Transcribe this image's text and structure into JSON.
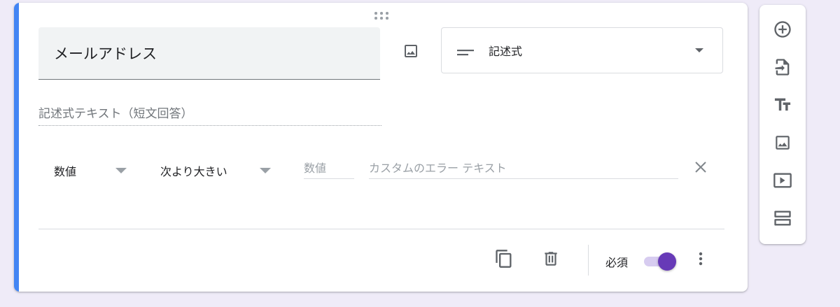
{
  "question": {
    "title": "メールアドレス",
    "type_label": "記述式",
    "answer_placeholder": "記述式テキスト（短文回答）"
  },
  "validation": {
    "type": "数値",
    "condition": "次より大きい",
    "number_placeholder": "数値",
    "error_placeholder": "カスタムのエラー テキスト"
  },
  "footer": {
    "required_label": "必須",
    "required_on": true
  },
  "sidebar": {
    "items": [
      {
        "icon": "add-circle-icon"
      },
      {
        "icon": "import-icon"
      },
      {
        "icon": "title-icon"
      },
      {
        "icon": "image-icon"
      },
      {
        "icon": "video-icon"
      },
      {
        "icon": "section-icon"
      }
    ]
  },
  "colors": {
    "accent": "#4285f4",
    "toggle": "#673ab7",
    "background": "#efebf8"
  }
}
